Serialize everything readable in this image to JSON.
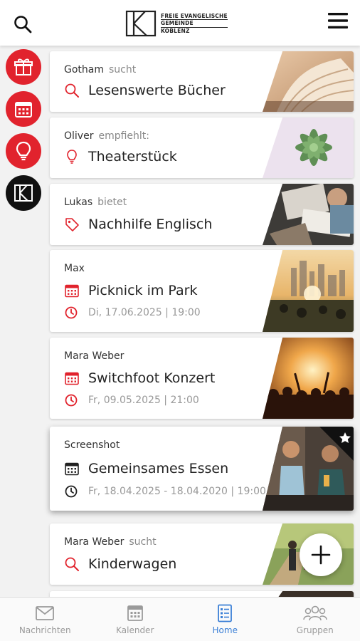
{
  "header": {
    "logo_lines": [
      "FREIE EVANGELISCHE",
      "GEMEINDE",
      "KOBLENZ"
    ]
  },
  "side_actions": [
    {
      "icon": "gift-icon",
      "color": "#e1232d"
    },
    {
      "icon": "calendar-icon",
      "color": "#e1232d"
    },
    {
      "icon": "lightbulb-icon",
      "color": "#e1232d"
    },
    {
      "icon": "feg-logo-icon",
      "color": "#111111"
    }
  ],
  "cards": [
    {
      "poster": "Gotham",
      "verb": "sucht",
      "icon": "search-icon",
      "title": "Lesenswerte Bücher",
      "date": "",
      "thumb": "open-book-photo"
    },
    {
      "poster": "Oliver",
      "verb": "empfiehlt:",
      "icon": "lightbulb-icon",
      "title": "Theaterstück",
      "date": "",
      "thumb": "succulent-photo"
    },
    {
      "poster": "Lukas",
      "verb": "bietet",
      "icon": "tag-icon",
      "title": "Nachhilfe Englisch",
      "date": "",
      "thumb": "study-desk-photo"
    },
    {
      "poster": "Max",
      "verb": "",
      "icon": "calendar-icon",
      "title": "Picknick im Park",
      "date": "Di, 17.06.2025 | 19:00",
      "thumb": "park-sunset-photo"
    },
    {
      "poster": "Mara Weber",
      "verb": "",
      "icon": "calendar-icon",
      "title": "Switchfoot Konzert",
      "date": "Fr, 09.05.2025 | 21:00",
      "thumb": "concert-photo"
    },
    {
      "poster": "Screenshot",
      "verb": "",
      "icon": "calendar-icon",
      "title": "Gemeinsames Essen",
      "date": "Fr, 18.04.2025 - 18.04.2020 | 19:00",
      "thumb": "friends-eating-photo",
      "starred": true
    },
    {
      "poster": "Mara Weber",
      "verb": "sucht",
      "icon": "search-icon",
      "title": "Kinderwagen",
      "date": "",
      "thumb": "family-walk-photo"
    }
  ],
  "nav": [
    {
      "label": "Nachrichten",
      "icon": "mail-icon",
      "active": false
    },
    {
      "label": "Kalender",
      "icon": "calendar-icon",
      "active": false
    },
    {
      "label": "Home",
      "icon": "list-icon",
      "active": true
    },
    {
      "label": "Gruppen",
      "icon": "group-icon",
      "active": false
    }
  ],
  "colors": {
    "accent_red": "#e1232d",
    "active_blue": "#3a7fd6",
    "muted": "#999999"
  }
}
